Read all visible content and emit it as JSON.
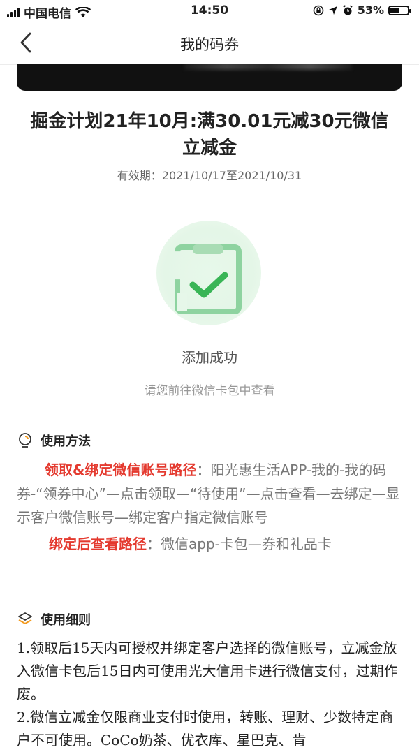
{
  "status_bar": {
    "carrier": "中国电信",
    "time": "14:50",
    "battery": "53%",
    "battery_level": 0.53
  },
  "nav": {
    "title": "我的码券"
  },
  "coupon": {
    "title": "掘金计划21年10月:满30.01元减30元微信立减金",
    "validity": "有效期：2021/10/17至2021/10/31"
  },
  "result": {
    "status": "添加成功",
    "hint": "请您前往微信卡包中查看"
  },
  "method": {
    "heading": "使用方法",
    "path1_label": "领取&绑定微信账号路径",
    "path1_text": "：阳光惠生活APP-我的-我的码券-“领券中心”—点击领取—“待使用”—点击查看—去绑定—显示客户微信账号—绑定客户指定微信账号",
    "path2_label": "绑定后查看路径",
    "path2_text": "：微信app-卡包—券和礼品卡"
  },
  "rules": {
    "heading": "使用细则",
    "items": [
      "1.领取后15天内可授权并绑定客户选择的微信账号，立减金放入微信卡包后15日内可使用光大信用卡进行微信支付，过期作废。",
      "2.微信立减金仅限商业支付时使用，转账、理财、少数特定商户不可使用。CoCo奶茶、优衣库、星巴克、肯"
    ]
  },
  "colors": {
    "accent_red": "#e43a2f",
    "success_green": "#3fbf5a"
  }
}
